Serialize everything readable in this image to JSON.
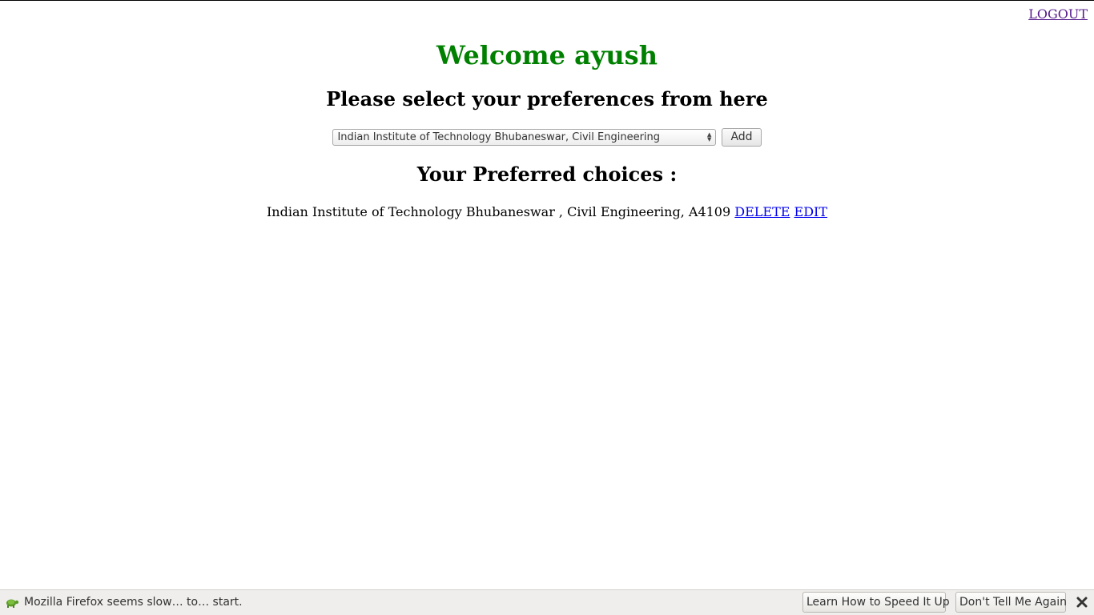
{
  "header": {
    "logout_label": "LOGOUT"
  },
  "main": {
    "welcome_text": "Welcome ayush",
    "select_heading": "Please select your preferences from here",
    "preference_select": {
      "selected_value": "Indian Institute of Technology Bhubaneswar, Civil Engineering"
    },
    "add_button_label": "Add",
    "choices_heading": "Your Preferred choices :",
    "choices": [
      {
        "text": "Indian Institute of Technology Bhubaneswar , Civil Engineering, A4109",
        "delete_label": "DELETE",
        "edit_label": "EDIT"
      }
    ]
  },
  "notification_bar": {
    "icon": "turtle-icon",
    "message": "Mozilla Firefox seems slow… to… start.",
    "speed_button_label": "Learn How to Speed It Up",
    "dont_tell_button_label": "Don't Tell Me Again",
    "close_icon": "close-icon"
  },
  "colors": {
    "welcome": "#008000",
    "link": "#0000ee",
    "visited_link": "#551a8b",
    "notification_bg": "#efeeec"
  }
}
